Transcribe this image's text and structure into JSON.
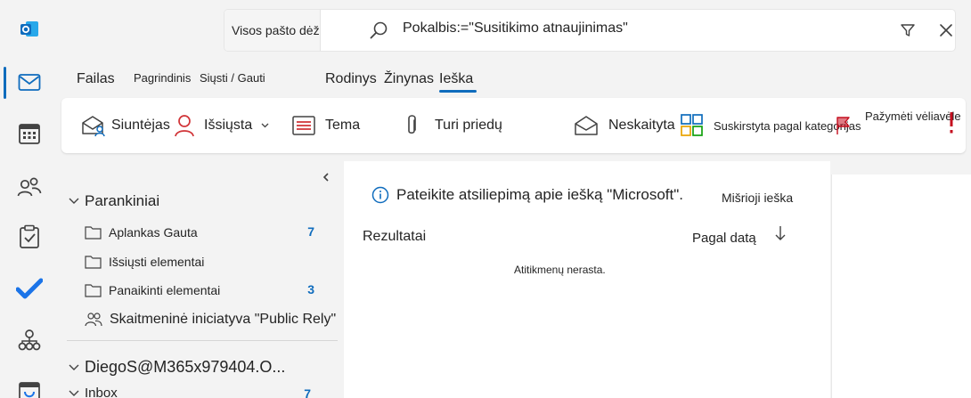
{
  "colors": {
    "accent": "#0f6cbd",
    "pane": "#f3f3f3",
    "surface": "#ffffff",
    "flag": "#c50f1f"
  },
  "rail": {
    "items": [
      {
        "name": "outlook-logo-icon"
      },
      {
        "name": "mail-icon",
        "active": true
      },
      {
        "name": "calendar-icon"
      },
      {
        "name": "people-icon"
      },
      {
        "name": "tasks-icon"
      },
      {
        "name": "todo-check-icon"
      },
      {
        "name": "org-chart-icon"
      },
      {
        "name": "apps-icon"
      }
    ]
  },
  "search": {
    "scope": "Visos pašto dėžutės",
    "query": "Pokalbis:=\"Susitikimo atnaujinimas\""
  },
  "tabs": [
    {
      "label": "Failas"
    },
    {
      "label": "Pagrindinis"
    },
    {
      "label": "Siųsti / Gauti"
    },
    {
      "label": "Rodinys"
    },
    {
      "label": "Žinynas"
    },
    {
      "label": "Ieška",
      "active": true
    }
  ],
  "ribbon": {
    "from": "Siuntėjas",
    "sent": "Išsiųsta",
    "subject": "Tema",
    "attachments": "Turi priedų",
    "unread": "Neskaityta",
    "categorized": "Suskirstyta pagal kategorijas",
    "flagged": "Pažymėti vėliavėle"
  },
  "folders": {
    "favorites_label": "Parankiniai",
    "items": [
      {
        "label": "Aplankas Gauta",
        "count": "7"
      },
      {
        "label": "Išsiųsti elementai",
        "count": ""
      },
      {
        "label": "Panaikinti elementai",
        "count": "3"
      }
    ],
    "group_item": "Skaitmeninė iniciatyva \"Public Rely\"",
    "account_label": "DiegoS@M365x979404.O...",
    "inbox_label": "Inbox",
    "inbox_count": "7"
  },
  "results": {
    "feedback": "Pateikite atsiliepimą apie iešką \"Microsoft\".",
    "hybrid": "Mišrioji ieška",
    "title": "Rezultatai",
    "sort_label": "Pagal datą",
    "empty": "Atitikmenų nerasta."
  }
}
